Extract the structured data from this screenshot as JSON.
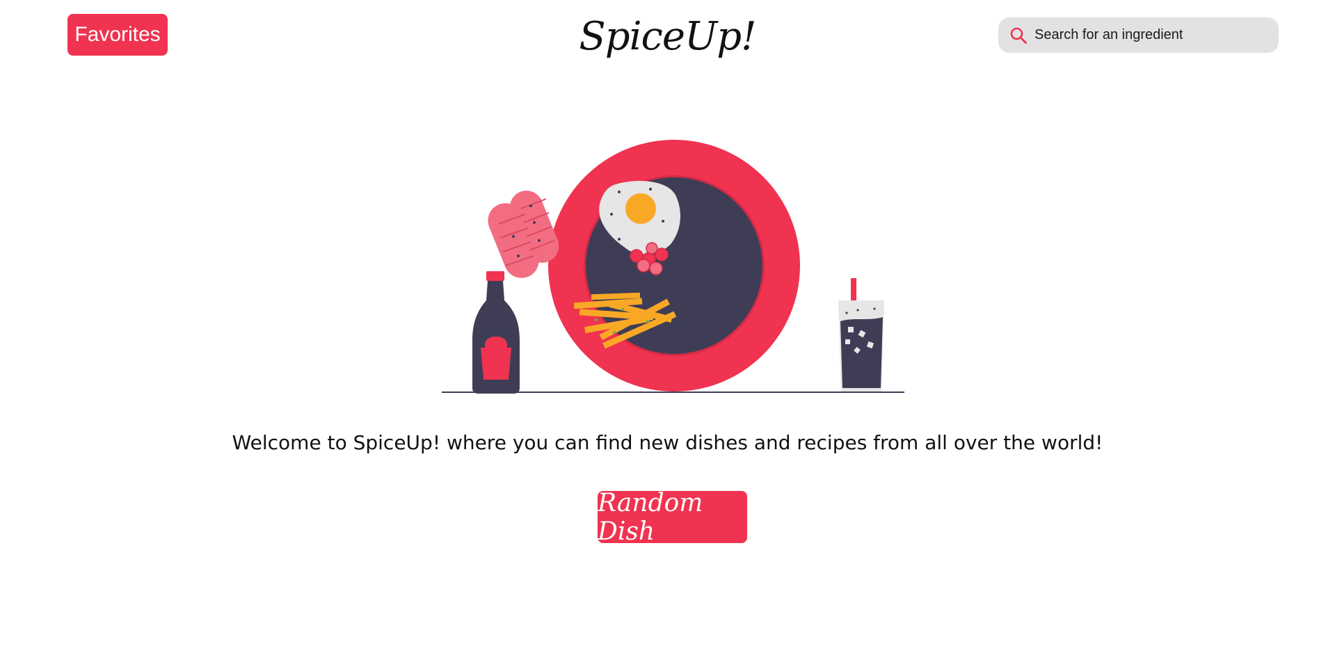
{
  "header": {
    "favorites_label": "Favorites",
    "logo_text": "SpiceUp!",
    "search": {
      "placeholder": "Search for an ingredient",
      "value": "",
      "icon": "search-icon"
    }
  },
  "main": {
    "illustration": {
      "name": "breakfast-plate-illustration",
      "colors": {
        "accent": "#ef3350",
        "dark": "#3f3d56",
        "yolk": "#f9a826",
        "egg_white": "#e6e6e6",
        "sausage": "#f36d82"
      }
    },
    "welcome_text": "Welcome to SpiceUp! where you can find new dishes and recipes from all over the world!",
    "random_dish_label": "Random Dish"
  },
  "colors": {
    "brand": "#ef3350",
    "search_background": "#e2e2e2",
    "text": "#111111"
  }
}
